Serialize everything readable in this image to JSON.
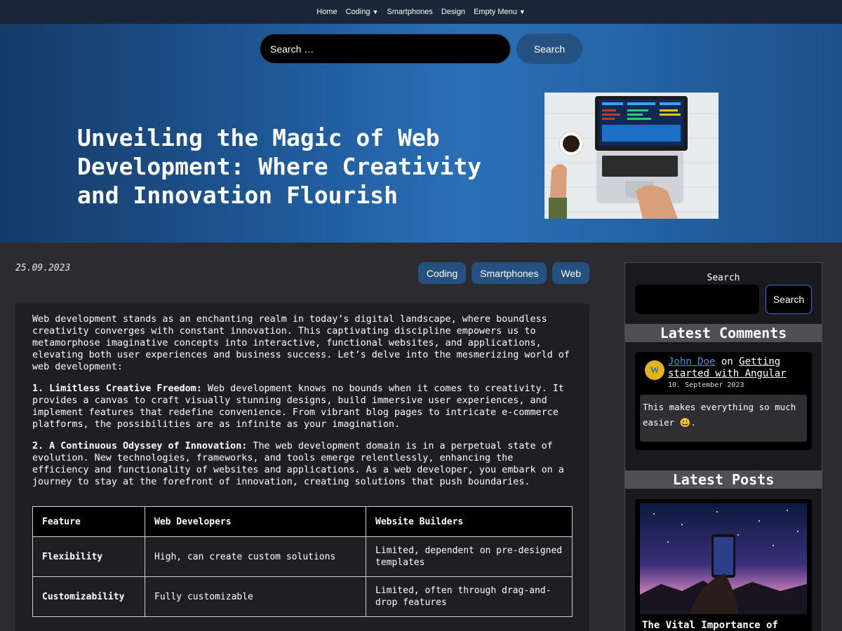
{
  "nav": {
    "items": [
      {
        "label": "Home",
        "caret": false
      },
      {
        "label": "Coding",
        "caret": true
      },
      {
        "label": "Smartphones",
        "caret": false
      },
      {
        "label": "Design",
        "caret": false
      },
      {
        "label": "Empty Menu",
        "caret": true
      }
    ]
  },
  "header_search": {
    "placeholder": "Search …",
    "button": "Search"
  },
  "hero": {
    "title": "Unveiling the Magic of Web Development: Where Creativity and Innovation Flourish"
  },
  "post": {
    "date": "25.09.2023",
    "tags": [
      "Coding",
      "Smartphones",
      "Web"
    ],
    "intro": "Web development stands as an enchanting realm in today’s digital landscape, where boundless creativity converges with constant innovation. This captivating discipline empowers us to metamorphose imaginative concepts into interactive, functional websites, and applications, elevating both user experiences and business success. Let’s delve into the mesmerizing world of web development:",
    "points": [
      {
        "heading": "1. Limitless Creative Freedom:",
        "text": " Web development knows no bounds when it comes to creativity. It provides a canvas to craft visually stunning designs, build immersive user experiences, and implement features that redefine convenience. From vibrant blog pages to intricate e-commerce platforms, the possibilities are as infinite as your imagination."
      },
      {
        "heading": "2. A Continuous Odyssey of Innovation:",
        "text": " The web development domain is in a perpetual state of evolution. New technologies, frameworks, and tools emerge relentlessly, enhancing the efficiency and functionality of websites and applications. As a web developer, you embark on a journey to stay at the forefront of innovation, creating solutions that push boundaries."
      }
    ],
    "table": {
      "headers": [
        "Feature",
        "Web Developers",
        "Website Builders"
      ],
      "rows": [
        [
          "Flexibility",
          "High, can create custom solutions",
          "Limited, dependent on pre-designed templates"
        ],
        [
          "Customizability",
          "Fully customizable",
          "Limited, often through drag-and-drop features"
        ]
      ]
    }
  },
  "sidebar": {
    "search_label": "Search",
    "search_button": "Search",
    "latest_comments_heading": "Latest Comments",
    "comment": {
      "author": "John Doe",
      "on": "on",
      "post": "Getting started with Angular",
      "date": "10. September 2023",
      "text": "This makes everything so much easier 😃."
    },
    "latest_posts_heading": "Latest Posts",
    "latest_post_title": "The Vital Importance of"
  }
}
